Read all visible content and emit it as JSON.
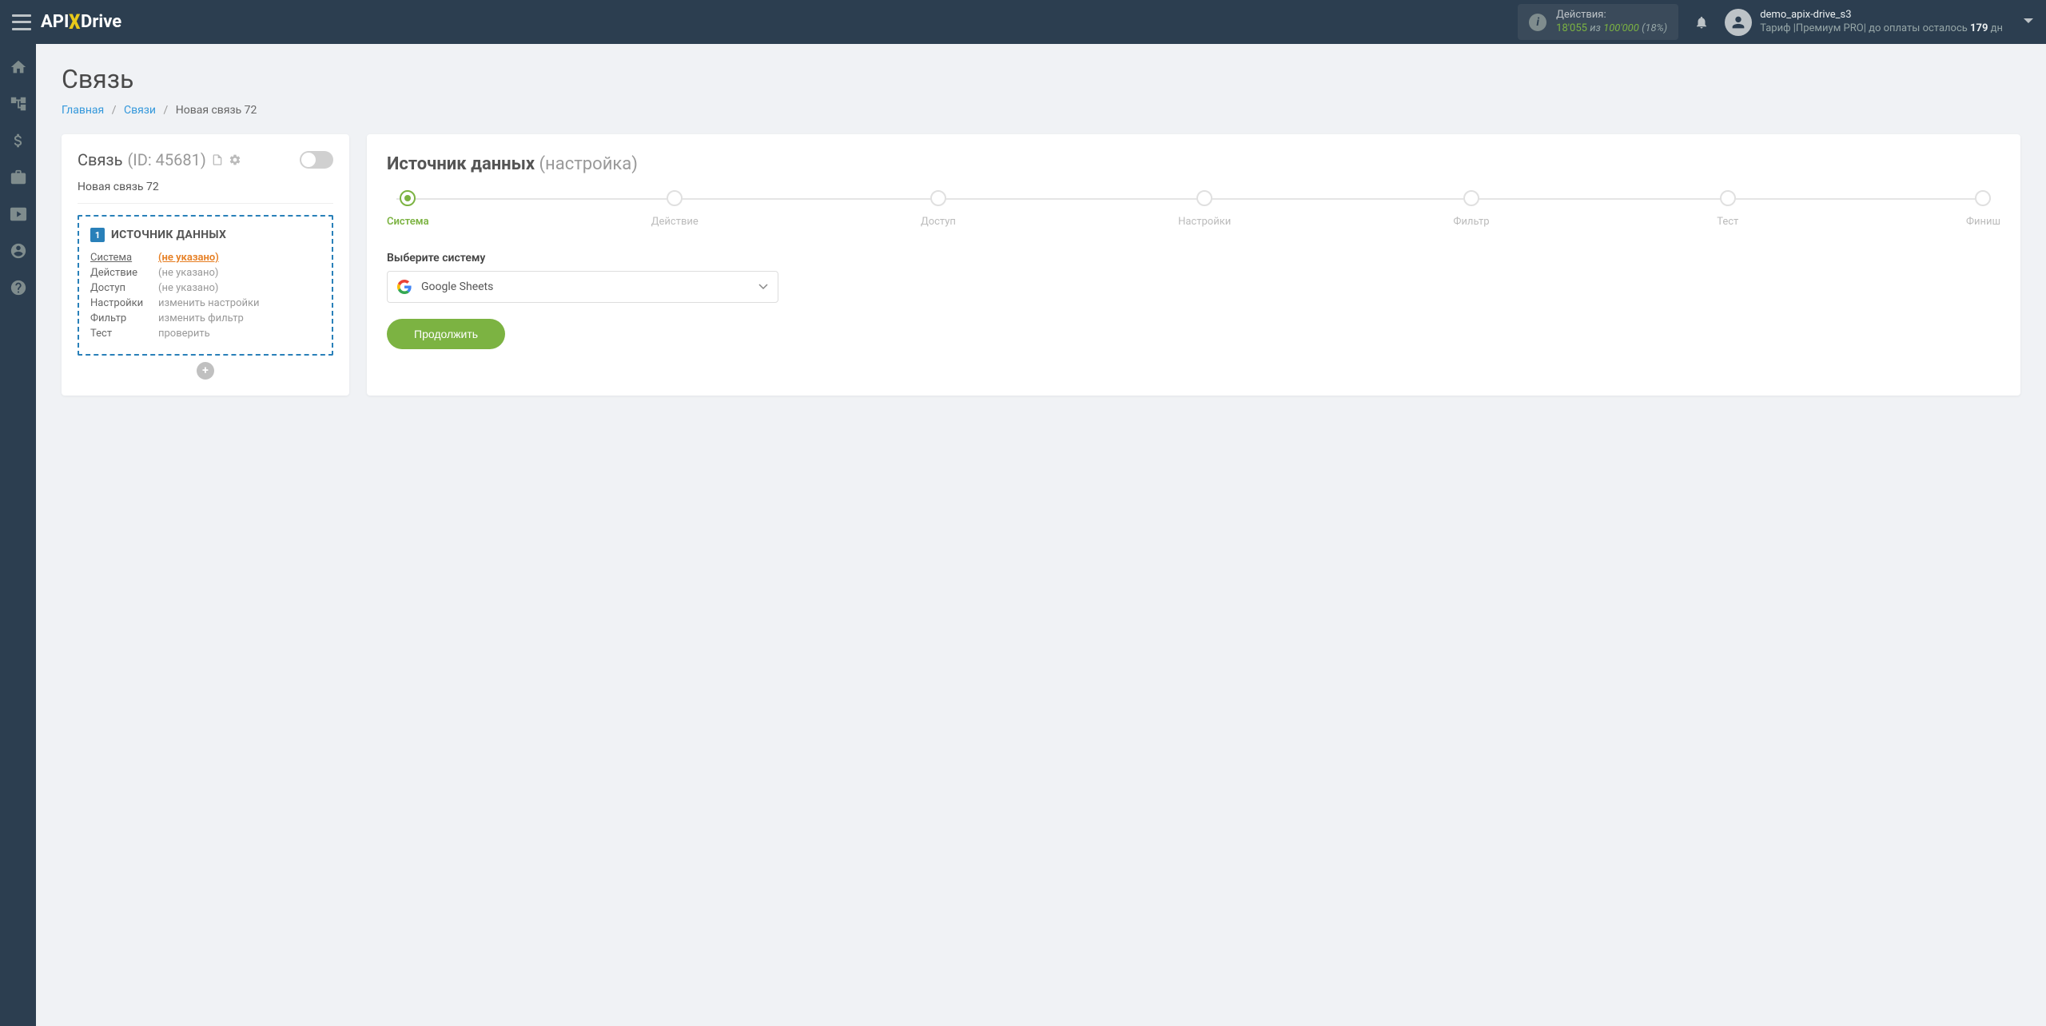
{
  "header": {
    "logo_pre": "API",
    "logo_post": "Drive",
    "actions_label": "Действия:",
    "actions_count": "18'055",
    "actions_iz": "из",
    "actions_total": "100'000",
    "actions_percent": "(18%)",
    "user_name": "demo_apix-drive_s3",
    "tariff_prefix": "Тариф |Премиум PRO| до оплаты осталось ",
    "tariff_days": "179",
    "tariff_suffix": " дн"
  },
  "page": {
    "title": "Связь",
    "breadcrumbs": {
      "home": "Главная",
      "links": "Связи",
      "current": "Новая связь 72",
      "sep": "/"
    }
  },
  "leftcard": {
    "title": "Связь",
    "id_label": "(ID: 45681)",
    "conn_name": "Новая связь 72",
    "srcbox": {
      "badge": "1",
      "title": "ИСТОЧНИК ДАННЫХ",
      "rows": [
        {
          "k": "Система",
          "v": "(не указано)",
          "underline_k": true,
          "link": true
        },
        {
          "k": "Действие",
          "v": "(не указано)"
        },
        {
          "k": "Доступ",
          "v": "(не указано)"
        },
        {
          "k": "Настройки",
          "v": "изменить настройки",
          "action": true
        },
        {
          "k": "Фильтр",
          "v": "изменить фильтр",
          "action": true
        },
        {
          "k": "Тест",
          "v": "проверить",
          "action": true
        }
      ],
      "add": "+"
    }
  },
  "rightcard": {
    "title": "Источник данных",
    "subtitle": "(настройка)",
    "steps": [
      "Система",
      "Действие",
      "Доступ",
      "Настройки",
      "Фильтр",
      "Тест",
      "Финиш"
    ],
    "active_step": 0,
    "select_label": "Выберите систему",
    "selected_system": "Google Sheets",
    "continue": "Продолжить"
  }
}
